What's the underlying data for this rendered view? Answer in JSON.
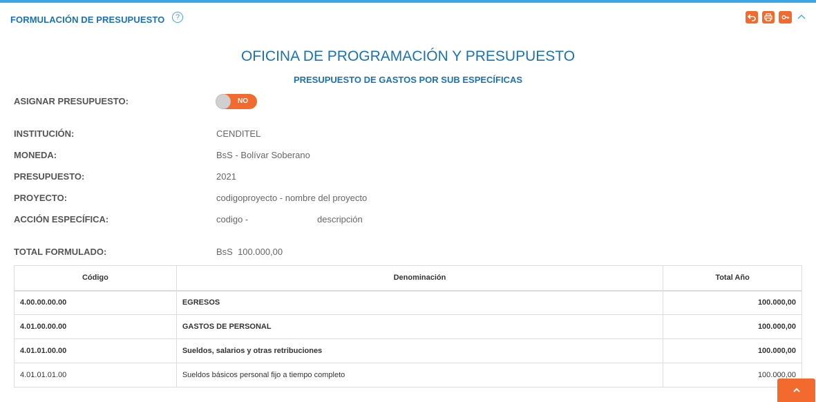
{
  "header": {
    "title": "FORMULACIÓN DE PRESUPUESTO",
    "help_icon": "question-circle-icon",
    "actions": {
      "back_icon": "undo-icon",
      "print_icon": "print-icon",
      "key_icon": "key-icon",
      "collapse_icon": "chevron-up-icon"
    }
  },
  "titles": {
    "main": "OFICINA DE PROGRAMACIÓN Y PRESUPUESTO",
    "sub": "PRESUPUESTO DE GASTOS POR SUB ESPECÍFICAS"
  },
  "assign": {
    "label": "ASIGNAR PRESUPUESTO:",
    "toggle_text": "NO"
  },
  "fields": {
    "institucion": {
      "label": "INSTITUCIÓN:",
      "value": "CENDITEL"
    },
    "moneda": {
      "label": "MONEDA:",
      "value": "BsS - Bolívar Soberano"
    },
    "presupuesto": {
      "label": "PRESUPUESTO:",
      "value": "2021"
    },
    "proyecto": {
      "label": "PROYECTO:",
      "value": "codigoproyecto - nombre del proyecto"
    },
    "accion": {
      "label": "ACCIÓN ESPECÍFICA:",
      "code": "codigo -",
      "description": "descripción"
    },
    "total": {
      "label": "TOTAL FORMULADO:",
      "value": "BsS  100.000,00"
    }
  },
  "table": {
    "headers": {
      "code": "Código",
      "denomination": "Denominación",
      "total": "Total Año"
    },
    "rows": [
      {
        "code": "4.00.00.00.00",
        "denomination": "EGRESOS",
        "total": "100.000,00"
      },
      {
        "code": "4.01.00.00.00",
        "denomination": "GASTOS DE PERSONAL",
        "total": "100.000,00"
      },
      {
        "code": "4.01.01.00.00",
        "denomination": "Sueldos, salarios y otras retribuciones",
        "total": "100.000,00"
      },
      {
        "code": "4.01.01.01.00",
        "denomination": "Sueldos básicos personal fijo a tiempo completo",
        "total": "100.000,00"
      }
    ]
  },
  "scroll_top_icon": "chevron-up-icon",
  "colors": {
    "accent": "#1a72b5",
    "action": "#f26a2d",
    "topbar": "#3aa6e6"
  }
}
